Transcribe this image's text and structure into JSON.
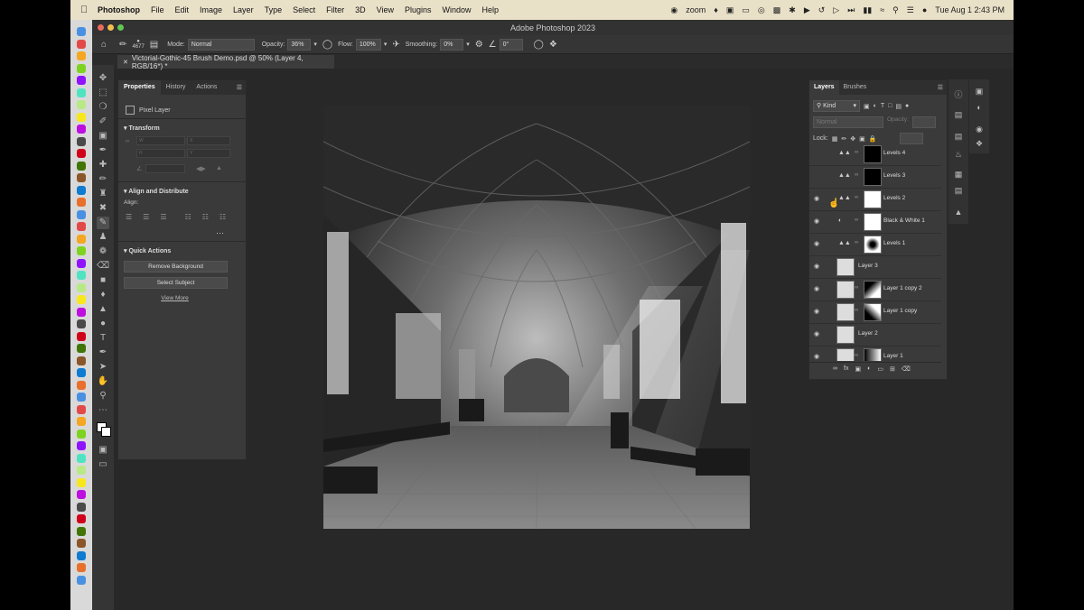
{
  "menubar": {
    "app_name": "Photoshop",
    "items": [
      "File",
      "Edit",
      "Image",
      "Layer",
      "Type",
      "Select",
      "Filter",
      "3D",
      "View",
      "Plugins",
      "Window",
      "Help"
    ],
    "zoom_label": "zoom",
    "clock": "Tue Aug 1  2:43 PM"
  },
  "window": {
    "title": "Adobe Photoshop 2023"
  },
  "options": {
    "brush_size": "4677",
    "mode_label": "Mode:",
    "mode_value": "Normal",
    "opacity_label": "Opacity:",
    "opacity_value": "36%",
    "flow_label": "Flow:",
    "flow_value": "100%",
    "smoothing_label": "Smoothing:",
    "smoothing_value": "0%",
    "angle_value": "0°"
  },
  "document": {
    "tab_title": "Victorial-Gothic-45 Brush Demo.psd @ 50% (Layer 4, RGB/16*) *"
  },
  "properties": {
    "tabs": [
      "Properties",
      "History",
      "Actions"
    ],
    "layer_type": "Pixel Layer",
    "transform_title": "Transform",
    "align_title": "Align and Distribute",
    "align_label": "Align:",
    "quick_actions_title": "Quick Actions",
    "remove_bg": "Remove Background",
    "select_subject": "Select Subject",
    "view_more": "View More"
  },
  "layers_panel": {
    "tabs": [
      "Layers",
      "Brushes"
    ],
    "kind_label": "Kind",
    "blend_mode": "Normal",
    "opacity_label": "Opacity:",
    "lock_label": "Lock:",
    "layers": [
      {
        "name": "Levels 4",
        "visible": false,
        "type": "adjustment",
        "mask": "black"
      },
      {
        "name": "Levels 3",
        "visible": false,
        "type": "adjustment",
        "mask": "black"
      },
      {
        "name": "Levels 2",
        "visible": true,
        "type": "adjustment",
        "mask": "white"
      },
      {
        "name": "Black & White 1",
        "visible": true,
        "type": "bw",
        "mask": "white"
      },
      {
        "name": "Levels 1",
        "visible": true,
        "type": "adjustment",
        "mask": "radial"
      },
      {
        "name": "Layer 3",
        "visible": true,
        "type": "pixel",
        "mask": "none"
      },
      {
        "name": "Layer 1 copy 2",
        "visible": true,
        "type": "pixel",
        "mask": "gradient"
      },
      {
        "name": "Layer 1 copy",
        "visible": true,
        "type": "pixel",
        "mask": "gradient"
      },
      {
        "name": "Layer 2",
        "visible": true,
        "type": "pixel",
        "mask": "none"
      },
      {
        "name": "Layer 1",
        "visible": true,
        "type": "pixel",
        "mask": "gradient"
      }
    ]
  },
  "colors": {
    "accent": "#2d8ceb",
    "panel": "#3a3a3a",
    "app_bg": "#282828"
  }
}
